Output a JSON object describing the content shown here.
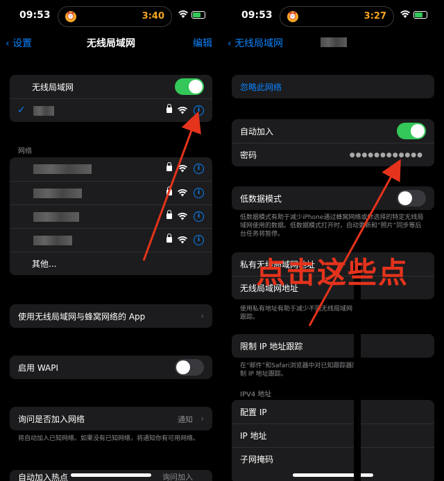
{
  "left": {
    "status": {
      "time": "09:53",
      "timer": "3:40"
    },
    "nav": {
      "back": "设置",
      "title": "无线局域网",
      "edit": "编辑"
    },
    "wifi_toggle_label": "无线局域网",
    "section_networks": "网络",
    "other": "其他...",
    "apps_row": "使用无线局域网与蜂窝网络的 App",
    "wapi_row": "启用 WAPI",
    "ask_row": {
      "label": "询问是否加入网络",
      "value": "通知"
    },
    "ask_footer": "将自动加入已知网络。如果没有已知网络，将通知你有可用网络。",
    "partial_row": {
      "label": "自动加入热点",
      "value": "询问加入"
    }
  },
  "right": {
    "status": {
      "time": "09:53",
      "timer": "3:27"
    },
    "nav": {
      "back": "无线局域网"
    },
    "forget": "忽略此网络",
    "auto_join": "自动加入",
    "password": {
      "label": "密码",
      "value": "●●●●●●●●●●●●"
    },
    "low_data": "低数据模式",
    "low_data_footer": "低数据模式有助于减少iPhone通过蜂窝网络或你选择的特定无线局域网使用的数据。低数据模式打开时，自动更新和“照片”同步等后台任务将暂停。",
    "private_row": "私有无线局域网地址",
    "private_row2": "无线局域网地址",
    "private_footer": "使用私有地址有助于减少不同无线局域网跟踪。",
    "limit_ip": "限制 IP 地址跟踪",
    "limit_ip_footer": "在“邮件”和Safari浏览器中对已知跟踪器限制 IP 地址跟踪。",
    "ipv4_label": "IPV4 地址",
    "config_ip": "配置 IP",
    "ip_addr": "IP 地址",
    "subnet": "子网掩码"
  },
  "annotation": "点击这些点",
  "colors": {
    "accent": "#0a84ff",
    "toggle_on": "#34c759",
    "annotation": "#e5331c"
  }
}
